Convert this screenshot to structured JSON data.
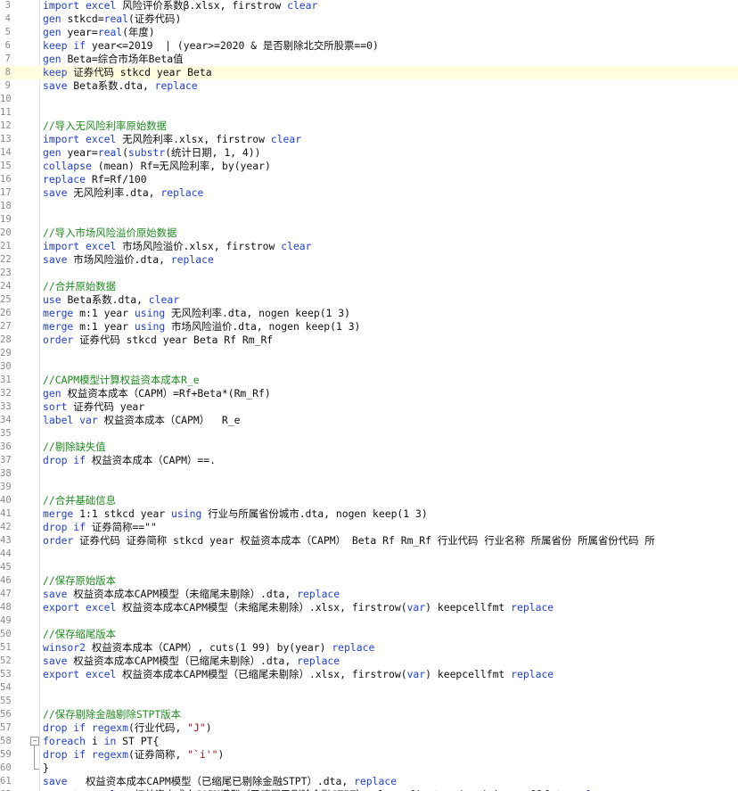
{
  "colors": {
    "keyword": "#1f3fd1",
    "comment": "#1f8a1f",
    "string": "#a01515",
    "plain": "#101010",
    "line_number": "#8a8a8a",
    "current_line": "#fffde0"
  },
  "editor": {
    "current_line_number": 8,
    "fold_icon": "minus-box-icon",
    "lines": [
      {
        "n": "3",
        "t": [
          [
            "k",
            "import excel "
          ],
          [
            "p",
            "风险评价系数β.xlsx, firstrow "
          ],
          [
            "k",
            "clear"
          ]
        ]
      },
      {
        "n": "4",
        "t": [
          [
            "k",
            "gen "
          ],
          [
            "p",
            "stkcd="
          ],
          [
            "f",
            "real"
          ],
          [
            "p",
            "(证券代码)"
          ]
        ]
      },
      {
        "n": "5",
        "t": [
          [
            "k",
            "gen "
          ],
          [
            "p",
            "year="
          ],
          [
            "f",
            "real"
          ],
          [
            "p",
            "(年度)"
          ]
        ]
      },
      {
        "n": "6",
        "t": [
          [
            "k",
            "keep if "
          ],
          [
            "p",
            "year<=2019  | (year>=2020 & 是否剔除北交所股票==0)"
          ]
        ]
      },
      {
        "n": "7",
        "t": [
          [
            "k",
            "gen "
          ],
          [
            "p",
            "Beta=综合市场年Beta值"
          ]
        ]
      },
      {
        "n": "8",
        "t": [
          [
            "k",
            "keep "
          ],
          [
            "p",
            "证券代码 stkcd year Beta"
          ]
        ]
      },
      {
        "n": "9",
        "t": [
          [
            "k",
            "save "
          ],
          [
            "p",
            "Beta系数.dta, "
          ],
          [
            "k",
            "replace"
          ]
        ]
      },
      {
        "n": "10",
        "t": []
      },
      {
        "n": "11",
        "t": []
      },
      {
        "n": "12",
        "t": [
          [
            "c",
            "//导入无风险利率原始数据"
          ]
        ]
      },
      {
        "n": "13",
        "t": [
          [
            "k",
            "import excel "
          ],
          [
            "p",
            "无风险利率.xlsx, firstrow "
          ],
          [
            "k",
            "clear"
          ]
        ]
      },
      {
        "n": "14",
        "t": [
          [
            "k",
            "gen "
          ],
          [
            "p",
            "year="
          ],
          [
            "f",
            "real"
          ],
          [
            "p",
            "("
          ],
          [
            "f",
            "substr"
          ],
          [
            "p",
            "(统计日期, 1, 4))"
          ]
        ]
      },
      {
        "n": "15",
        "t": [
          [
            "k",
            "collapse "
          ],
          [
            "p",
            "(mean) Rf=无风险利率, by(year)"
          ]
        ]
      },
      {
        "n": "16",
        "t": [
          [
            "k",
            "replace "
          ],
          [
            "p",
            "Rf=Rf/100"
          ]
        ]
      },
      {
        "n": "17",
        "t": [
          [
            "k",
            "save "
          ],
          [
            "p",
            "无风险利率.dta, "
          ],
          [
            "k",
            "replace"
          ]
        ]
      },
      {
        "n": "18",
        "t": []
      },
      {
        "n": "19",
        "t": []
      },
      {
        "n": "20",
        "t": [
          [
            "c",
            "//导入市场风险溢价原始数据"
          ]
        ]
      },
      {
        "n": "21",
        "t": [
          [
            "k",
            "import excel "
          ],
          [
            "p",
            "市场风险溢价.xlsx, firstrow "
          ],
          [
            "k",
            "clear"
          ]
        ]
      },
      {
        "n": "22",
        "t": [
          [
            "k",
            "save "
          ],
          [
            "p",
            "市场风险溢价.dta, "
          ],
          [
            "k",
            "replace"
          ]
        ]
      },
      {
        "n": "23",
        "t": []
      },
      {
        "n": "24",
        "t": [
          [
            "c",
            "//合并原始数据"
          ]
        ]
      },
      {
        "n": "25",
        "t": [
          [
            "k",
            "use "
          ],
          [
            "p",
            "Beta系数.dta, "
          ],
          [
            "k",
            "clear"
          ]
        ]
      },
      {
        "n": "26",
        "t": [
          [
            "k",
            "merge "
          ],
          [
            "p",
            "m:1 year "
          ],
          [
            "k",
            "using "
          ],
          [
            "p",
            "无风险利率.dta, nogen keep(1 3)"
          ]
        ]
      },
      {
        "n": "27",
        "t": [
          [
            "k",
            "merge "
          ],
          [
            "p",
            "m:1 year "
          ],
          [
            "k",
            "using "
          ],
          [
            "p",
            "市场风险溢价.dta, nogen keep(1 3)"
          ]
        ]
      },
      {
        "n": "28",
        "t": [
          [
            "k",
            "order "
          ],
          [
            "p",
            "证券代码 stkcd year Beta Rf Rm_Rf"
          ]
        ]
      },
      {
        "n": "29",
        "t": []
      },
      {
        "n": "30",
        "t": []
      },
      {
        "n": "31",
        "t": [
          [
            "c",
            "//CAPM模型计算权益资本成本R_e"
          ]
        ]
      },
      {
        "n": "32",
        "t": [
          [
            "k",
            "gen "
          ],
          [
            "p",
            "权益资本成本（CAPM）=Rf+Beta*(Rm_Rf)"
          ]
        ]
      },
      {
        "n": "33",
        "t": [
          [
            "k",
            "sort "
          ],
          [
            "p",
            "证券代码 year"
          ]
        ]
      },
      {
        "n": "34",
        "t": [
          [
            "k",
            "label var "
          ],
          [
            "p",
            "权益资本成本（CAPM）  R_e"
          ]
        ]
      },
      {
        "n": "35",
        "t": []
      },
      {
        "n": "36",
        "t": [
          [
            "c",
            "//剔除缺失值"
          ]
        ]
      },
      {
        "n": "37",
        "t": [
          [
            "k",
            "drop if "
          ],
          [
            "p",
            "权益资本成本（CAPM）==."
          ]
        ]
      },
      {
        "n": "38",
        "t": []
      },
      {
        "n": "39",
        "t": []
      },
      {
        "n": "40",
        "t": [
          [
            "c",
            "//合并基础信息"
          ]
        ]
      },
      {
        "n": "41",
        "t": [
          [
            "k",
            "merge "
          ],
          [
            "p",
            "1:1 stkcd year "
          ],
          [
            "k",
            "using "
          ],
          [
            "p",
            "行业与所属省份城市.dta, nogen keep(1 3)"
          ]
        ]
      },
      {
        "n": "42",
        "t": [
          [
            "k",
            "drop if "
          ],
          [
            "p",
            "证券简称==\"\""
          ]
        ]
      },
      {
        "n": "43",
        "t": [
          [
            "k",
            "order "
          ],
          [
            "p",
            "证券代码 证券简称 stkcd year 权益资本成本（CAPM） Beta Rf Rm_Rf 行业代码 行业名称 所属省份 所属省份代码 所"
          ]
        ]
      },
      {
        "n": "44",
        "t": []
      },
      {
        "n": "45",
        "t": []
      },
      {
        "n": "46",
        "t": [
          [
            "c",
            "//保存原始版本"
          ]
        ]
      },
      {
        "n": "47",
        "t": [
          [
            "k",
            "save "
          ],
          [
            "p",
            "权益资本成本CAPM模型（未缩尾未剔除）.dta, "
          ],
          [
            "k",
            "replace"
          ]
        ]
      },
      {
        "n": "48",
        "t": [
          [
            "k",
            "export excel "
          ],
          [
            "p",
            "权益资本成本CAPM模型（未缩尾未剔除）.xlsx, firstrow("
          ],
          [
            "k",
            "var"
          ],
          [
            "p",
            ") keepcellfmt "
          ],
          [
            "k",
            "replace"
          ]
        ]
      },
      {
        "n": "49",
        "t": []
      },
      {
        "n": "50",
        "t": [
          [
            "c",
            "//保存缩尾版本"
          ]
        ]
      },
      {
        "n": "51",
        "t": [
          [
            "k",
            "winsor2 "
          ],
          [
            "p",
            "权益资本成本（CAPM）, cuts(1 99) by(year) "
          ],
          [
            "k",
            "replace"
          ]
        ]
      },
      {
        "n": "52",
        "t": [
          [
            "k",
            "save "
          ],
          [
            "p",
            "权益资本成本CAPM模型（已缩尾未剔除）.dta, "
          ],
          [
            "k",
            "replace"
          ]
        ]
      },
      {
        "n": "53",
        "t": [
          [
            "k",
            "export excel "
          ],
          [
            "p",
            "权益资本成本CAPM模型（已缩尾未剔除）.xlsx, firstrow("
          ],
          [
            "k",
            "var"
          ],
          [
            "p",
            ") keepcellfmt "
          ],
          [
            "k",
            "replace"
          ]
        ]
      },
      {
        "n": "54",
        "t": []
      },
      {
        "n": "55",
        "t": []
      },
      {
        "n": "56",
        "t": [
          [
            "c",
            "//保存剔除金融剔除STPT版本"
          ]
        ]
      },
      {
        "n": "57",
        "t": [
          [
            "k",
            "drop if "
          ],
          [
            "f",
            "regexm"
          ],
          [
            "p",
            "(行业代码, "
          ],
          [
            "s",
            "\"J\""
          ],
          [
            "p",
            ")"
          ]
        ]
      },
      {
        "n": "58",
        "t": [
          [
            "k",
            "foreach "
          ],
          [
            "p",
            "i "
          ],
          [
            "k",
            "in "
          ],
          [
            "p",
            "ST PT{"
          ]
        ]
      },
      {
        "n": "59",
        "t": [
          [
            "k",
            "drop if "
          ],
          [
            "f",
            "regexm"
          ],
          [
            "p",
            "(证券简称, "
          ],
          [
            "s",
            "\"`i'\""
          ],
          [
            "p",
            ")"
          ]
        ]
      },
      {
        "n": "60",
        "t": [
          [
            "p",
            "}"
          ]
        ]
      },
      {
        "n": "61",
        "t": [
          [
            "k",
            "save "
          ],
          [
            "p",
            "  权益资本成本CAPM模型（已缩尾已剔除金融STPT）.dta, "
          ],
          [
            "k",
            "replace"
          ]
        ]
      },
      {
        "n": "62",
        "t": [
          [
            "k",
            "export excel "
          ],
          [
            "p",
            "  权益资本成本CAPM模型（已缩尾已剔除金融STPT）.xlsx, firstrow("
          ],
          [
            "k",
            "var"
          ],
          [
            "p",
            ") keepcellfmt "
          ],
          [
            "k",
            "replace"
          ]
        ]
      }
    ]
  }
}
